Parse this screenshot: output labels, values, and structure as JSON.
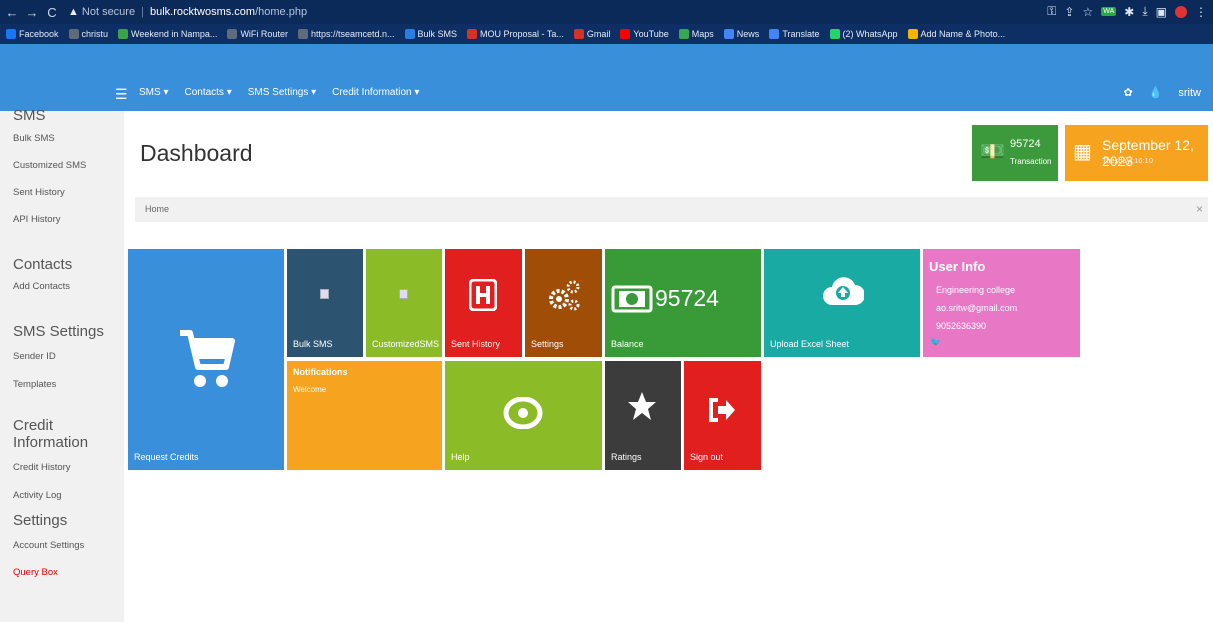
{
  "browser": {
    "back": "←",
    "forward": "→",
    "reload": "C",
    "security_icon": "warning-icon",
    "security_text": "Not secure",
    "url_host": "bulk.rocktwosms.com",
    "url_path": "/home.php",
    "extension_label": "WA"
  },
  "bookmarks": [
    {
      "label": "Facebook",
      "icon": "facebook-icon",
      "color": "#1877f2"
    },
    {
      "label": "christu",
      "icon": "globe-icon",
      "color": "#5f6b7a"
    },
    {
      "label": "Weekend in Nampa...",
      "icon": "bookmark-icon",
      "color": "#3aa34a"
    },
    {
      "label": "WiFi Router",
      "icon": "globe-icon",
      "color": "#5f6b7a"
    },
    {
      "label": "https://tseamcetd.n...",
      "icon": "globe-icon",
      "color": "#5f6b7a"
    },
    {
      "label": "Bulk SMS",
      "icon": "bookmark-icon",
      "color": "#2a7de1"
    },
    {
      "label": "MOU Proposal - Ta...",
      "icon": "gmail-icon",
      "color": "#d93025"
    },
    {
      "label": "Gmail",
      "icon": "gmail-icon",
      "color": "#d93025"
    },
    {
      "label": "YouTube",
      "icon": "youtube-icon",
      "color": "#ff0000"
    },
    {
      "label": "Maps",
      "icon": "maps-icon",
      "color": "#34a853"
    },
    {
      "label": "News",
      "icon": "news-icon",
      "color": "#4285f4"
    },
    {
      "label": "Translate",
      "icon": "translate-icon",
      "color": "#4285f4"
    },
    {
      "label": "(2) WhatsApp",
      "icon": "whatsapp-icon",
      "color": "#25d366"
    },
    {
      "label": "Add Name & Photo...",
      "icon": "bookmark-icon",
      "color": "#f4b400"
    }
  ],
  "nav": {
    "menu": [
      "SMS ▾",
      "Contacts ▾",
      "SMS Settings ▾",
      "Credit Information ▾"
    ],
    "user": "sritw"
  },
  "sidebar": {
    "sections": [
      {
        "title": "SMS",
        "items": [
          "Bulk SMS",
          "Customized SMS",
          "Sent History",
          "API History"
        ]
      },
      {
        "title": "Contacts",
        "items": [
          "Add Contacts"
        ]
      },
      {
        "title": "SMS Settings",
        "items": [
          "Sender ID",
          "Templates"
        ]
      },
      {
        "title": "Credit Information",
        "items": [
          "Credit History",
          "Activity Log"
        ]
      },
      {
        "title": "Settings",
        "items": [
          "Account Settings"
        ]
      }
    ],
    "query_box": "Query Box"
  },
  "main": {
    "title": "Dashboard",
    "breadcrumb": "Home",
    "breadcrumb_close": "×",
    "stat_transaction": {
      "value": "95724",
      "label": "Transaction"
    },
    "stat_date": {
      "value": "September 12, 2023",
      "label": "Tuesday, 16:10"
    }
  },
  "tiles": {
    "request_credits": "Request Credits",
    "bulk_sms": "Bulk SMS",
    "customized_sms": "CustomizedSMS",
    "sent_history": "Sent History",
    "settings": "Settings",
    "balance": "Balance",
    "balance_value": "95724",
    "upload_excel": "Upload Excel Sheet",
    "user_info": {
      "title": "User Info",
      "org": "Engineering college",
      "email": "ao.sritw@gmail.com",
      "phone": "9052636390"
    },
    "notifications": {
      "title": "Notifications",
      "message": "Welcome"
    },
    "help": "Help",
    "ratings": "Ratings",
    "sign_out": "Sign out"
  },
  "colors": {
    "nav": "#3a8fdb",
    "request_credits": "#3a8fdb",
    "bulk_sms": "#2c5470",
    "customized_sms": "#8bbb26",
    "sent_history": "#e21f1f",
    "settings": "#a04d08",
    "balance": "#389b37",
    "upload_excel": "#19aaa4",
    "user_info": "#e878c6",
    "notifications": "#f6a31f",
    "help": "#8bbb26",
    "ratings": "#3c3c3c",
    "sign_out": "#e21f1f"
  }
}
